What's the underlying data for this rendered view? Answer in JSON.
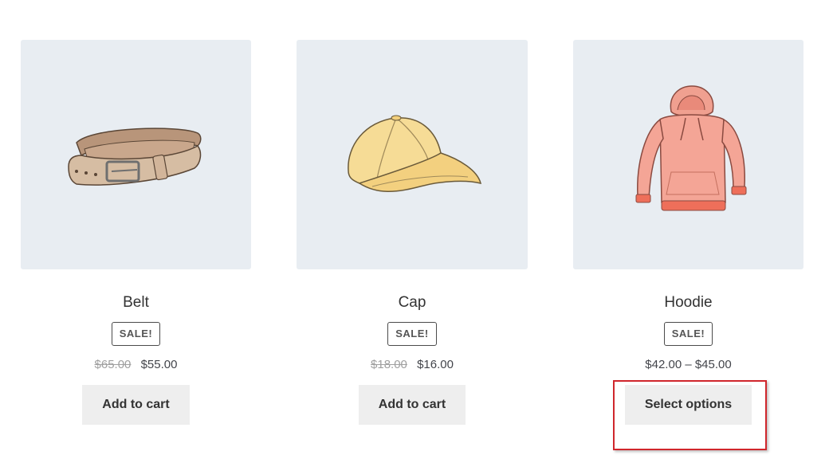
{
  "products": [
    {
      "name": "Belt",
      "badge": "SALE!",
      "old_price": "$65.00",
      "price": "$55.00",
      "button": "Add to cart",
      "image_icon": "belt-illustration"
    },
    {
      "name": "Cap",
      "badge": "SALE!",
      "old_price": "$18.00",
      "price": "$16.00",
      "button": "Add to cart",
      "image_icon": "cap-illustration"
    },
    {
      "name": "Hoodie",
      "badge": "SALE!",
      "price_range": "$42.00 – $45.00",
      "button": "Select options",
      "image_icon": "hoodie-illustration"
    }
  ],
  "colors": {
    "thumb_bg": "#e8edf2",
    "button_bg": "#eeeeee",
    "highlight": "#d0262c"
  }
}
